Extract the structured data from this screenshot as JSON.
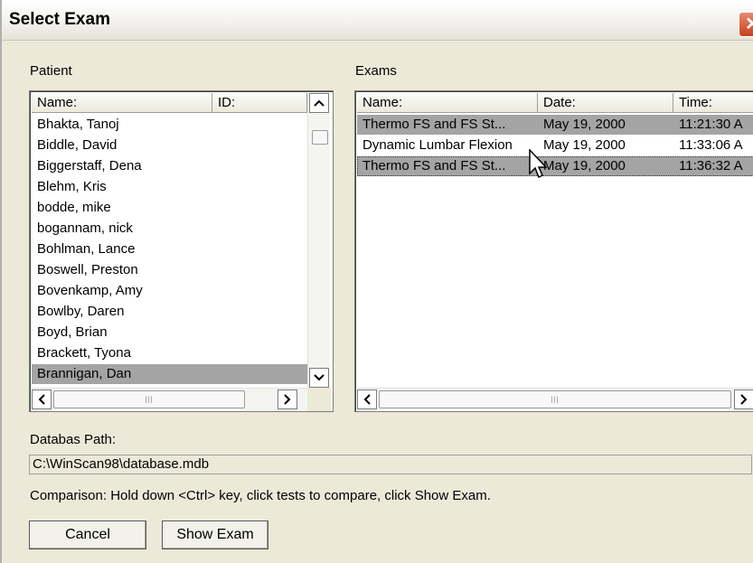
{
  "window": {
    "title": "Select Exam"
  },
  "patient": {
    "group_label": "Patient",
    "columns": [
      "Name:",
      "ID:"
    ],
    "rows": [
      {
        "name": "Bhakta, Tanoj",
        "id": ""
      },
      {
        "name": "Biddle, David",
        "id": ""
      },
      {
        "name": "Biggerstaff, Dena",
        "id": ""
      },
      {
        "name": "Blehm, Kris",
        "id": ""
      },
      {
        "name": "bodde, mike",
        "id": ""
      },
      {
        "name": "bogannam, nick",
        "id": ""
      },
      {
        "name": "Bohlman, Lance",
        "id": ""
      },
      {
        "name": "Boswell, Preston",
        "id": ""
      },
      {
        "name": "Bovenkamp, Amy",
        "id": ""
      },
      {
        "name": "Bowlby, Daren",
        "id": ""
      },
      {
        "name": "Boyd, Brian",
        "id": ""
      },
      {
        "name": "Brackett, Tyona",
        "id": ""
      },
      {
        "name": "Brannigan, Dan",
        "id": "",
        "selected": true
      }
    ]
  },
  "exams": {
    "group_label": "Exams",
    "columns": [
      "Name:",
      "Date:",
      "Time:"
    ],
    "rows": [
      {
        "name": "Thermo FS and FS St...",
        "date": "May 19, 2000",
        "time": "11:21:30 A",
        "selected": true
      },
      {
        "name": "Dynamic Lumbar Flexion",
        "date": "May 19, 2000",
        "time": "11:33:06 A",
        "selected": false
      },
      {
        "name": "Thermo FS and FS St...",
        "date": "May 19, 2000",
        "time": "11:36:32 A",
        "selected": true
      }
    ]
  },
  "database": {
    "label": "Databas Path:",
    "path": "C:\\WinScan98\\database.mdb"
  },
  "hint": "Comparison: Hold down <Ctrl> key, click tests to compare, click Show Exam.",
  "buttons": {
    "cancel": "Cancel",
    "show_exam": "Show Exam"
  },
  "icons": {
    "close": "close-icon",
    "scroll_up": "arrow-up-icon",
    "scroll_down": "arrow-down-icon",
    "scroll_left": "arrow-left-icon",
    "scroll_right": "arrow-right-icon",
    "cursor": "mouse-pointer-icon"
  },
  "colors": {
    "selection": "#a4a4a4",
    "close_button": "#c9411c",
    "background": "#ece9d8"
  }
}
